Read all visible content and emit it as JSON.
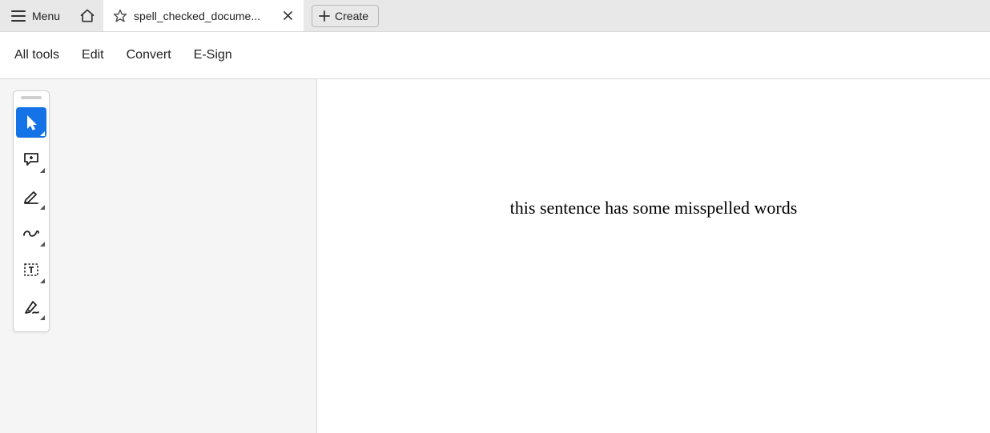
{
  "titlebar": {
    "menu_label": "Menu",
    "tab_title": "spell_checked_docume...",
    "create_label": "Create"
  },
  "menubar": {
    "items": [
      "All tools",
      "Edit",
      "Convert",
      "E-Sign"
    ]
  },
  "tools": {
    "select": "select-tool",
    "comment": "comment-tool",
    "highlight": "highlight-tool",
    "draw": "draw-tool",
    "textbox": "textbox-tool",
    "sign": "sign-tool"
  },
  "document": {
    "body_text": "this sentence has some misspelled words"
  }
}
